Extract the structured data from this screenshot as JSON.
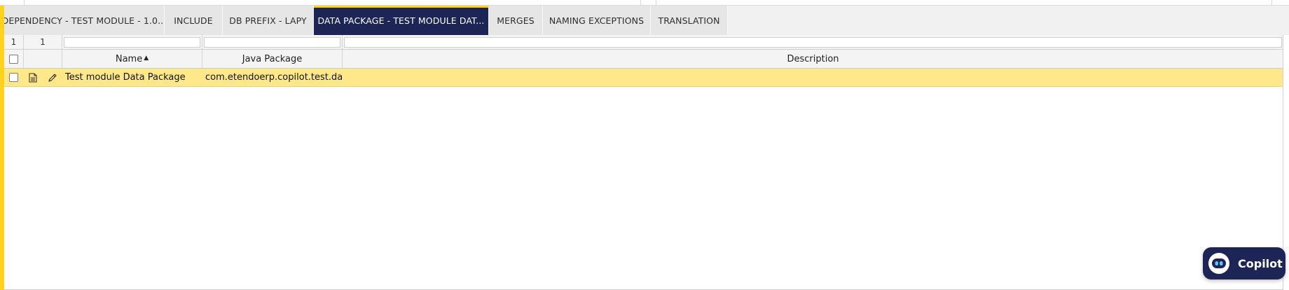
{
  "tabs": [
    {
      "label": "DEPENDENCY - TEST MODULE - 1.0...",
      "active": false
    },
    {
      "label": "INCLUDE",
      "active": false
    },
    {
      "label": "DB PREFIX - LAPY",
      "active": false
    },
    {
      "label": "DATA PACKAGE - TEST MODULE DAT...",
      "active": true
    },
    {
      "label": "MERGES",
      "active": false
    },
    {
      "label": "NAMING EXCEPTIONS",
      "active": false
    },
    {
      "label": "TRANSLATION",
      "active": false
    }
  ],
  "grid": {
    "counters": {
      "selected": "1",
      "total": "1"
    },
    "columns": {
      "name": "Name",
      "name_sort_indicator": "▲",
      "java_package": "Java Package",
      "description": "Description"
    },
    "rows": [
      {
        "name": "Test module Data Package",
        "java_package": "com.etendoerp.copilot.test.da...",
        "description": ""
      }
    ]
  },
  "copilot": {
    "label": "Copilot",
    "icon": "robot-icon"
  },
  "colors": {
    "accent": "#ffd21f",
    "active_tab": "#1d2456",
    "selected_row": "#ffe88a"
  }
}
